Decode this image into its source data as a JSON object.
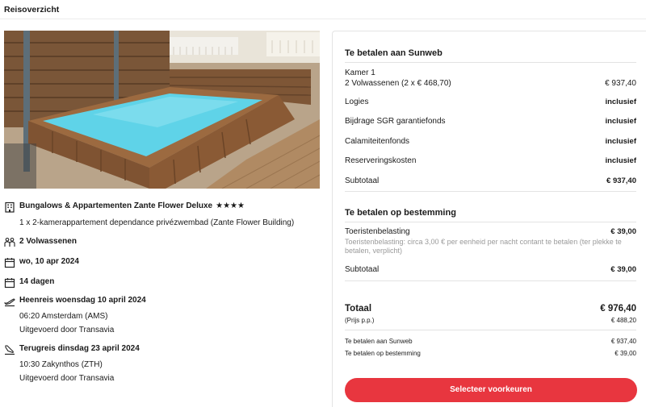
{
  "header": {
    "title": "Reisoverzicht"
  },
  "hotel": {
    "name": "Bungalows & Appartementen Zante Flower Deluxe",
    "stars": "★★★★",
    "room": "1 x 2-kamerappartement dependance privézwembad (Zante Flower Building)"
  },
  "travellers": "2 Volwassenen",
  "date": "wo, 10 apr 2024",
  "duration": "14 dagen",
  "outbound": {
    "title": "Heenreis woensdag 10 april 2024",
    "time": "06:20 Amsterdam (AMS)",
    "carrier": "Uitgevoerd door Transavia"
  },
  "return": {
    "title": "Terugreis dinsdag 23 april 2024",
    "time": "10:30 Zakynthos (ZTH)",
    "carrier": "Uitgevoerd door Transavia"
  },
  "pay_sunweb": {
    "title": "Te betalen aan Sunweb",
    "room_label": "Kamer 1",
    "room_detail": "2 Volwassenen (2 x € 468,70)",
    "room_price": "€ 937,40",
    "items": [
      {
        "label": "Logies",
        "value": "inclusief"
      },
      {
        "label": "Bijdrage SGR garantiefonds",
        "value": "inclusief"
      },
      {
        "label": "Calamiteitenfonds",
        "value": "inclusief"
      },
      {
        "label": "Reserveringskosten",
        "value": "inclusief"
      }
    ],
    "subtotal_label": "Subtotaal",
    "subtotal_value": "€ 937,40"
  },
  "pay_destination": {
    "title": "Te betalen op bestemming",
    "tax_label": "Toeristenbelasting",
    "tax_value": "€ 39,00",
    "tax_note": "Toeristenbelasting: circa 3,00 € per eenheid per nacht contant te betalen (ter plekke te betalen, verplicht)",
    "subtotal_label": "Subtotaal",
    "subtotal_value": "€ 39,00"
  },
  "total": {
    "label": "Totaal",
    "value": "€ 976,40",
    "pp_label": "(Prijs p.p.)",
    "pp_value": "€ 488,20",
    "sunweb_label": "Te betalen aan Sunweb",
    "sunweb_value": "€ 937,40",
    "dest_label": "Te betalen op bestemming",
    "dest_value": "€ 39,00"
  },
  "cta": {
    "label": "Selecteer voorkeuren"
  },
  "colors": {
    "accent": "#e8363f",
    "pool": "#5fd3e8",
    "wood": "#8a5a35"
  }
}
